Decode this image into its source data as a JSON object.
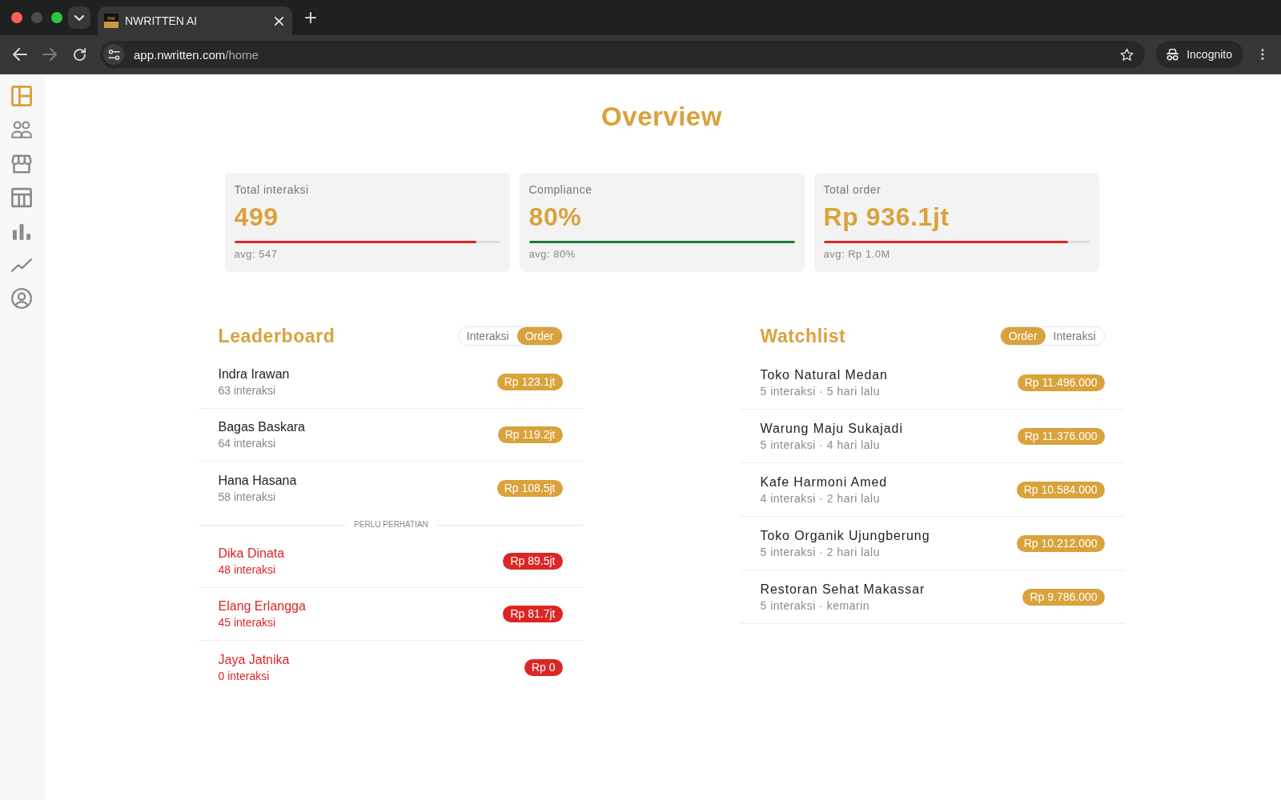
{
  "browser": {
    "tab": {
      "favicon_text": "nw",
      "title": "NWRITTEN AI"
    },
    "address": {
      "host": "app.nwritten.com",
      "path": "/home"
    },
    "profile_button": {
      "label": "Incognito"
    }
  },
  "sidebar": {
    "items": [
      {
        "kind": "dashboard",
        "selected": true
      },
      {
        "kind": "users",
        "selected": false
      },
      {
        "kind": "store",
        "selected": false
      },
      {
        "kind": "table",
        "selected": false
      },
      {
        "kind": "bars",
        "selected": false
      },
      {
        "kind": "trend",
        "selected": false
      },
      {
        "kind": "profile",
        "selected": false
      }
    ]
  },
  "page_title": "Overview",
  "stat_cards": [
    {
      "label": "Total interaksi",
      "value": "499",
      "bar": {
        "level": 0.91,
        "color": "#dc2626"
      },
      "avg": "avg: 547"
    },
    {
      "label": "Compliance",
      "value": "80%",
      "bar": {
        "level": 1.0,
        "color": "#1b7a35"
      },
      "avg": "avg: 80%"
    },
    {
      "label": "Total order",
      "value": "Rp 936.1jt",
      "bar": {
        "level": 0.92,
        "color": "#dc2626"
      },
      "avg": "avg: Rp 1.0M"
    }
  ],
  "leaderboard": {
    "title": "Leaderboard",
    "toggle": [
      {
        "label": "Interaksi",
        "selected": false
      },
      {
        "label": "Order",
        "selected": true
      }
    ],
    "groups": [
      {
        "rows": [
          {
            "name": "Indra Irawan",
            "detail": "63 interaksi",
            "amount": "Rp 123.1jt",
            "warning": false
          },
          {
            "name": "Bagas Baskara",
            "detail": "64 interaksi",
            "amount": "Rp 119.2jt",
            "warning": false
          },
          {
            "name": "Hana Hasana",
            "detail": "58 interaksi",
            "amount": "Rp 108.5jt",
            "warning": false
          }
        ]
      },
      {
        "label": "PERLU PERHATIAN",
        "rows": [
          {
            "name": "Dika Dinata",
            "detail": "48 interaksi",
            "amount": "Rp 89.5jt",
            "warning": true
          },
          {
            "name": "Elang Erlangga",
            "detail": "45 interaksi",
            "amount": "Rp 81.7jt",
            "warning": true
          },
          {
            "name": "Jaya Jatnika",
            "detail": "0 interaksi",
            "amount": "Rp 0",
            "warning": true
          }
        ]
      }
    ]
  },
  "watchlist": {
    "title": "Watchlist",
    "toggle": [
      {
        "label": "Order",
        "selected": true
      },
      {
        "label": "Interaksi",
        "selected": false
      }
    ],
    "rows": [
      {
        "name": "Toko Natural Medan",
        "detail": "5 interaksi · 5 hari lalu",
        "amount": "Rp 11.496.000"
      },
      {
        "name": "Warung Maju Sukajadi",
        "detail": "5 interaksi · 4 hari lalu",
        "amount": "Rp 11.376.000"
      },
      {
        "name": "Kafe Harmoni Amed",
        "detail": "4 interaksi · 2 hari lalu",
        "amount": "Rp 10.584.000"
      },
      {
        "name": "Toko Organik Ujungberung",
        "detail": "5 interaksi · 2 hari lalu",
        "amount": "Rp 10.212.000"
      },
      {
        "name": "Restoran Sehat Makassar",
        "detail": "5 interaksi · kemarin",
        "amount": "Rp 9.786.000"
      }
    ]
  }
}
